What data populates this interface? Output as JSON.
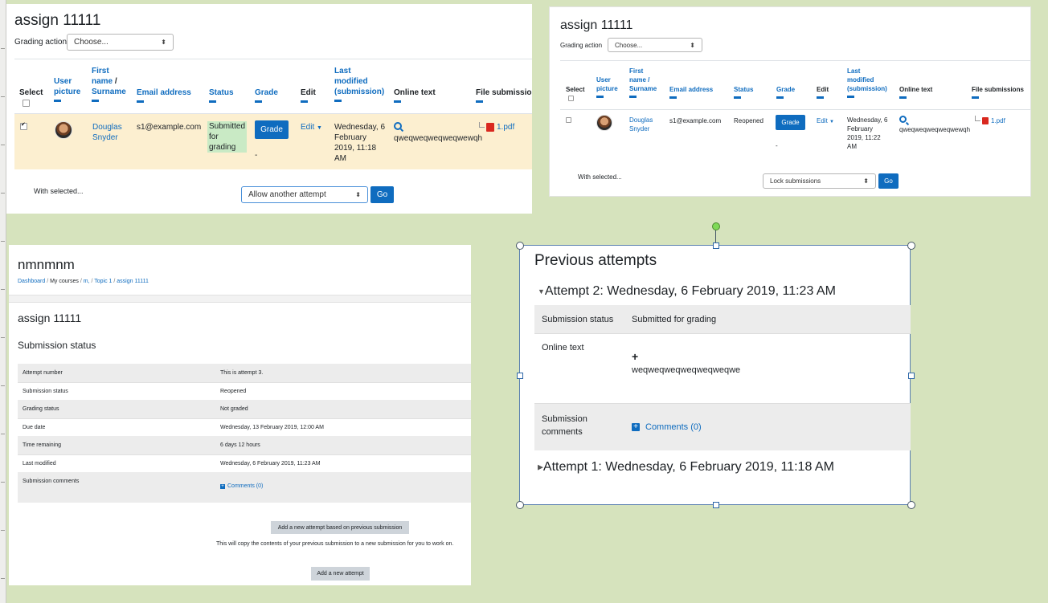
{
  "top_left": {
    "title": "assign 11111",
    "grading_action_label": "Grading action",
    "grading_action_value": "Choose...",
    "headers": {
      "select": "Select",
      "user_picture": [
        "User",
        "picture"
      ],
      "name": [
        "First",
        "name",
        "/",
        "Surname"
      ],
      "email": "Email address",
      "status": "Status",
      "grade": "Grade",
      "edit": "Edit",
      "last_modified": [
        "Last",
        "modified",
        "(submission)"
      ],
      "online_text": "Online text",
      "file_submissions": "File submissions"
    },
    "row": {
      "name": [
        "Douglas",
        "Snyder"
      ],
      "email": "s1@example.com",
      "status": [
        "Submitted",
        "for",
        "grading"
      ],
      "grade_button": "Grade",
      "grade_value": "-",
      "edit": "Edit",
      "last_modified": [
        "Wednesday, 6",
        "February",
        "2019, 11:18",
        "AM"
      ],
      "online_text": "qweqweqweqweqwewqh",
      "file": "1.pdf"
    },
    "with_selected": "With selected...",
    "bulk_action": "Allow another attempt",
    "go": "Go"
  },
  "top_right": {
    "title": "assign 11111",
    "grading_action_label": "Grading action",
    "grading_action_value": "Choose...",
    "headers": {
      "select": "Select",
      "user_picture": [
        "User",
        "picture"
      ],
      "name": [
        "First",
        "name /",
        "Surname"
      ],
      "email": "Email address",
      "status": "Status",
      "grade": "Grade",
      "edit": "Edit",
      "last_modified": [
        "Last",
        "modified",
        "(submission)"
      ],
      "online_text": "Online text",
      "file_submissions": "File submissions"
    },
    "row": {
      "name": [
        "Douglas",
        "Snyder"
      ],
      "email": "s1@example.com",
      "status": "Reopened",
      "grade_button": "Grade",
      "grade_value": "-",
      "edit": "Edit",
      "last_modified": [
        "Wednesday, 6",
        "February",
        "2019, 11:22",
        "AM"
      ],
      "online_text": "qweqweqweqweqwewqh",
      "file": "1.pdf"
    },
    "with_selected": "With selected...",
    "bulk_action": "Lock submissions",
    "go": "Go"
  },
  "bottom_left": {
    "course_title": "nmnmnm",
    "breadcrumb": [
      "Dashboard",
      "My courses",
      "m,",
      "Topic 1",
      "assign 11111"
    ],
    "title": "assign 11111",
    "section": "Submission status",
    "rows": [
      {
        "label": "Attempt number",
        "value": "This is attempt 3."
      },
      {
        "label": "Submission status",
        "value": "Reopened"
      },
      {
        "label": "Grading status",
        "value": "Not graded"
      },
      {
        "label": "Due date",
        "value": "Wednesday, 13 February 2019, 12:00 AM"
      },
      {
        "label": "Time remaining",
        "value": "6 days 12 hours"
      },
      {
        "label": "Last modified",
        "value": "Wednesday, 6 February 2019, 11:23 AM"
      },
      {
        "label": "Submission comments",
        "value": "Comments (0)"
      }
    ],
    "btn_prev": "Add a new attempt based on previous submission",
    "copy_note": "This will copy the contents of your previous submission to a new submission for you to work on.",
    "btn_new": "Add a new attempt"
  },
  "bottom_right": {
    "title": "Previous attempts",
    "attempt2": "Attempt 2: Wednesday, 6 February 2019, 11:23 AM",
    "submission_status_label": "Submission status",
    "submission_status_value": "Submitted for grading",
    "online_text_label": "Online text",
    "online_text_value": "weqweqweqweqweqweqwe",
    "comments_label": [
      "Submission",
      "comments"
    ],
    "comments_link": "Comments (0)",
    "attempt1": "Attempt 1: Wednesday, 6 February 2019, 11:18 AM"
  },
  "colors": {
    "background": "#d6e3bd",
    "link": "#0f6cbf",
    "selected_row": "#fcefd0",
    "status_submitted": "#c9eac5"
  }
}
